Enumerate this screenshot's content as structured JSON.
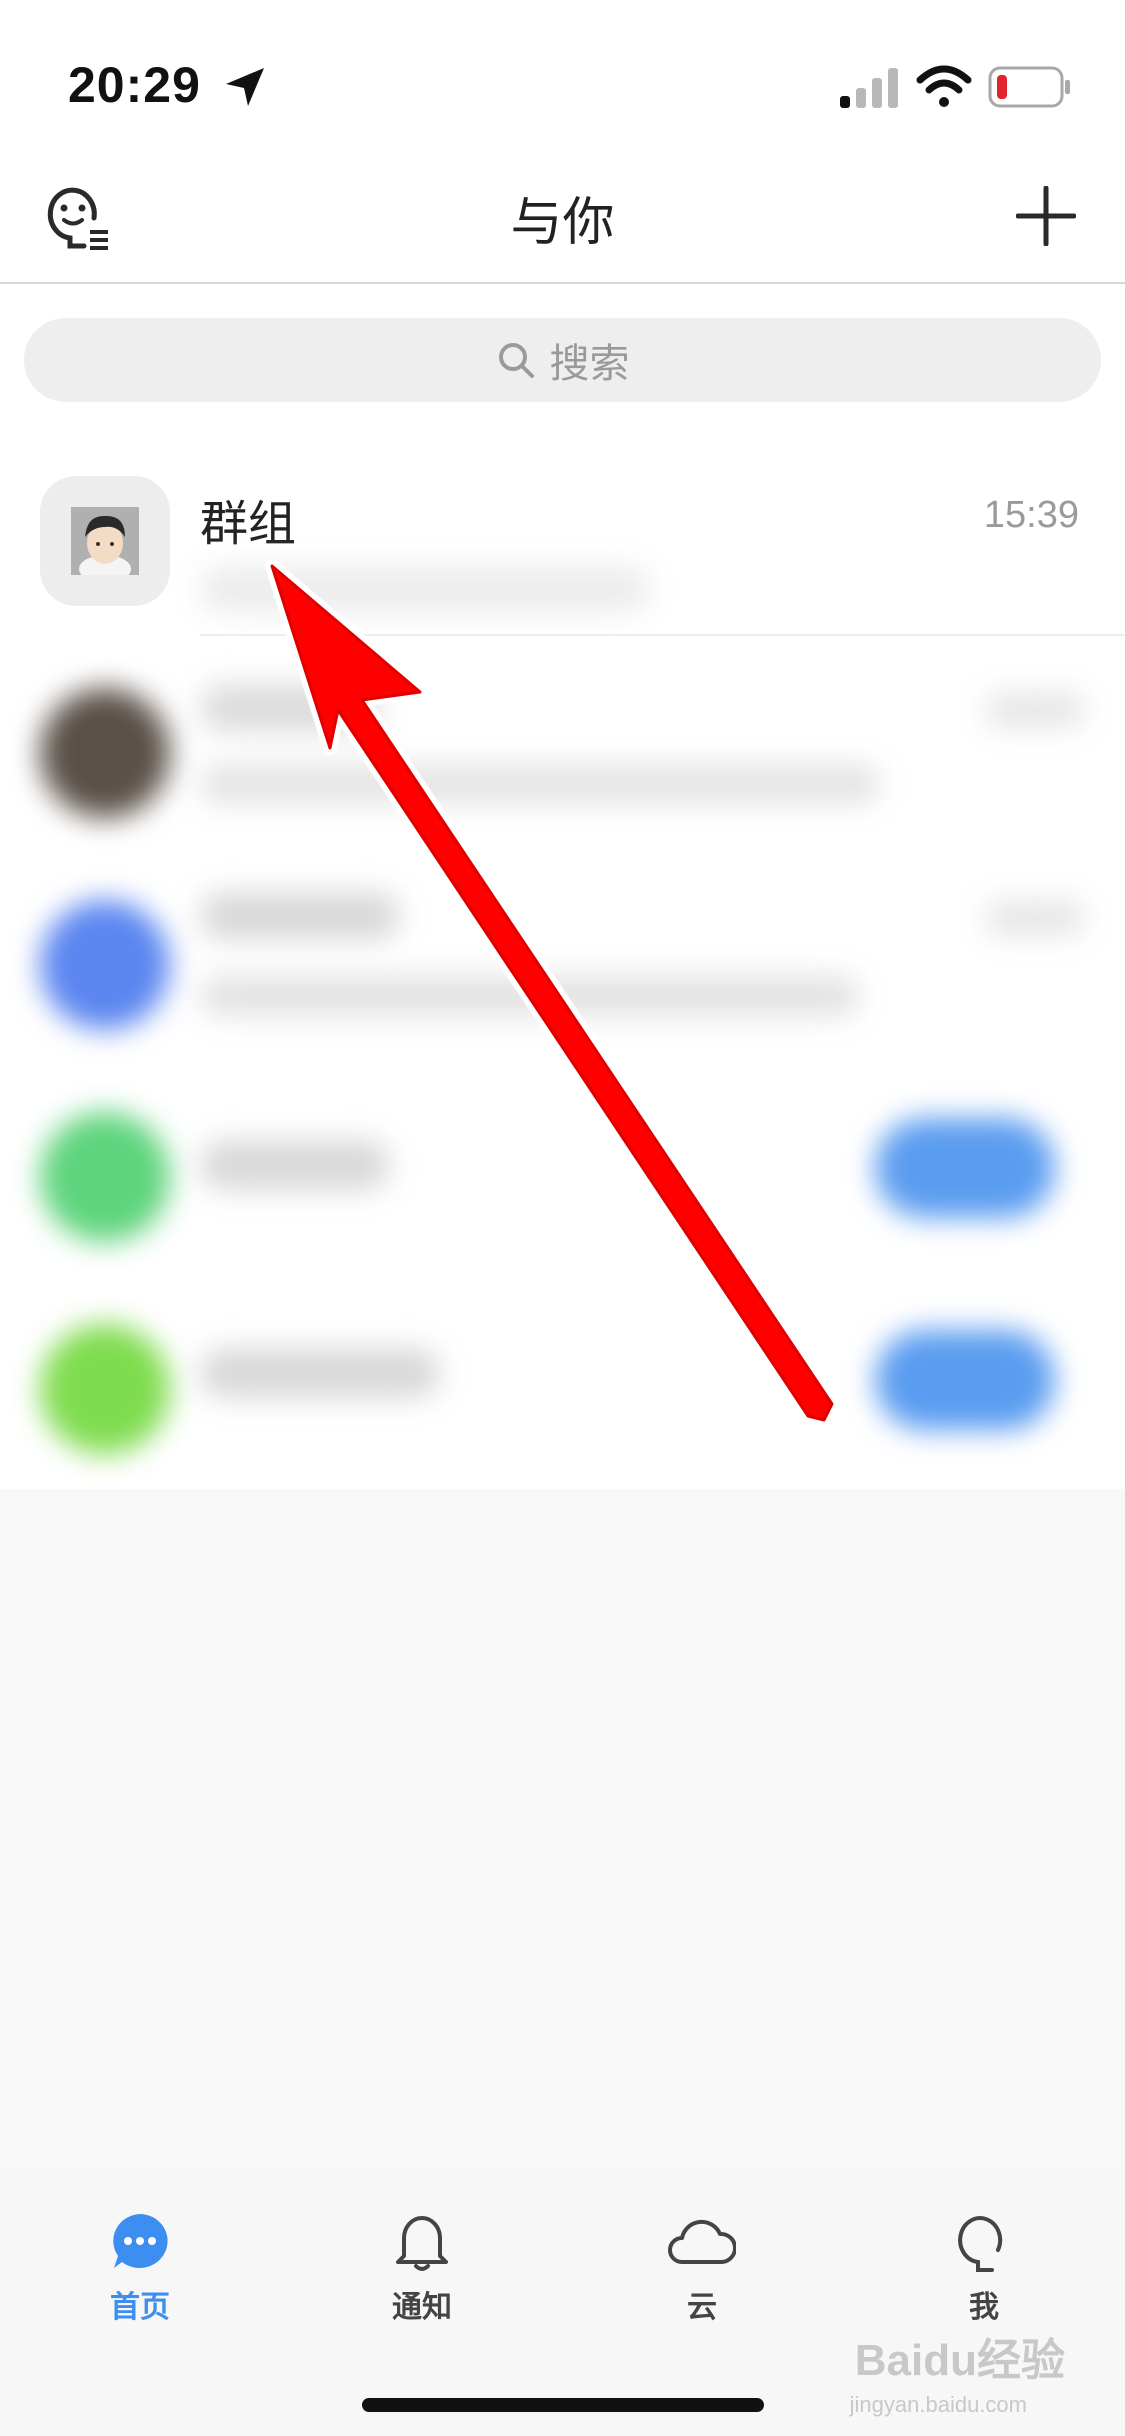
{
  "status_bar": {
    "time": "20:29",
    "icons": [
      "location-arrow-icon",
      "cellular-signal-icon",
      "wifi-icon",
      "battery-low-icon"
    ]
  },
  "navbar": {
    "title": "与你",
    "left_icon": "face-list-icon",
    "right_icon": "plus-icon"
  },
  "search": {
    "placeholder": "搜索",
    "icon": "search-icon"
  },
  "conversations": [
    {
      "title": "群组",
      "time": "15:39",
      "preview": "",
      "blurred": false
    },
    {
      "title": "",
      "time": "",
      "preview": "",
      "blurred": true
    },
    {
      "title": "",
      "time": "",
      "preview": "",
      "blurred": true
    },
    {
      "title": "",
      "time": "",
      "preview": "",
      "blurred": true
    },
    {
      "title": "",
      "time": "",
      "preview": "",
      "blurred": true
    }
  ],
  "tabbar": {
    "tabs": [
      {
        "label": "首页",
        "icon": "chat-bubble-icon",
        "active": true
      },
      {
        "label": "通知",
        "icon": "bell-icon",
        "active": false
      },
      {
        "label": "云",
        "icon": "cloud-icon",
        "active": false
      },
      {
        "label": "我",
        "icon": "person-icon",
        "active": false
      }
    ]
  },
  "annotation": {
    "arrow_color": "#ff0000"
  },
  "watermark": {
    "text": "Baidu经验",
    "sub": "jingyan.baidu.com"
  },
  "colors": {
    "accent": "#3c8ff0",
    "background": "#f8f8f8"
  }
}
